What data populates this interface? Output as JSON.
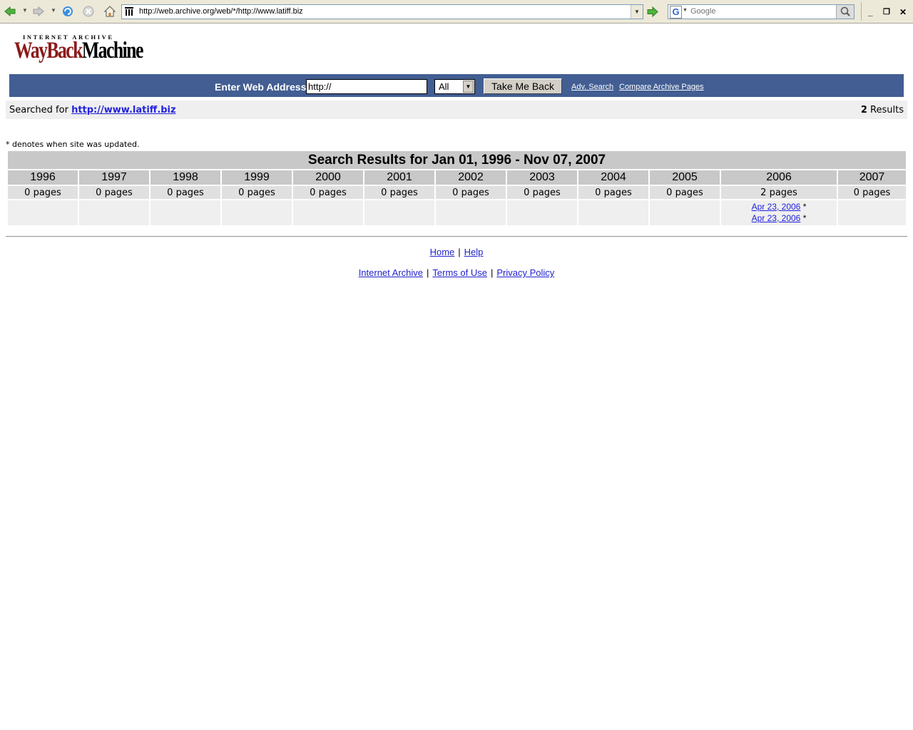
{
  "browser": {
    "address": "http://web.archive.org/web/*/http://www.latiff.biz",
    "search_placeholder": "Google"
  },
  "logo": {
    "line1": "INTERNET ARCHIVE",
    "wayback": "WayBack",
    "machine": "Machine"
  },
  "searchbar": {
    "label": "Enter Web Address:",
    "url_value": "http://",
    "type_selected": "All",
    "button": "Take Me Back",
    "adv_search": "Adv. Search",
    "compare": "Compare Archive Pages"
  },
  "searched": {
    "prefix": "Searched for",
    "url": "http://www.latiff.biz",
    "count": "2",
    "count_suffix": "Results"
  },
  "note": "* denotes when site was updated.",
  "results": {
    "title": "Search Results for Jan 01, 1996 - Nov 07, 2007",
    "years": [
      "1996",
      "1997",
      "1998",
      "1999",
      "2000",
      "2001",
      "2002",
      "2003",
      "2004",
      "2005",
      "2006",
      "2007"
    ],
    "pages": [
      "0 pages",
      "0 pages",
      "0 pages",
      "0 pages",
      "0 pages",
      "0 pages",
      "0 pages",
      "0 pages",
      "0 pages",
      "0 pages",
      "2 pages",
      "0 pages"
    ],
    "captures_2006": [
      {
        "date": "Apr 23, 2006",
        "mark": "*"
      },
      {
        "date": "Apr 23, 2006",
        "mark": "*"
      }
    ]
  },
  "footer": {
    "home": "Home",
    "help": "Help",
    "internet_archive": "Internet Archive",
    "terms": "Terms of Use",
    "privacy": "Privacy Policy",
    "separator": "|"
  }
}
